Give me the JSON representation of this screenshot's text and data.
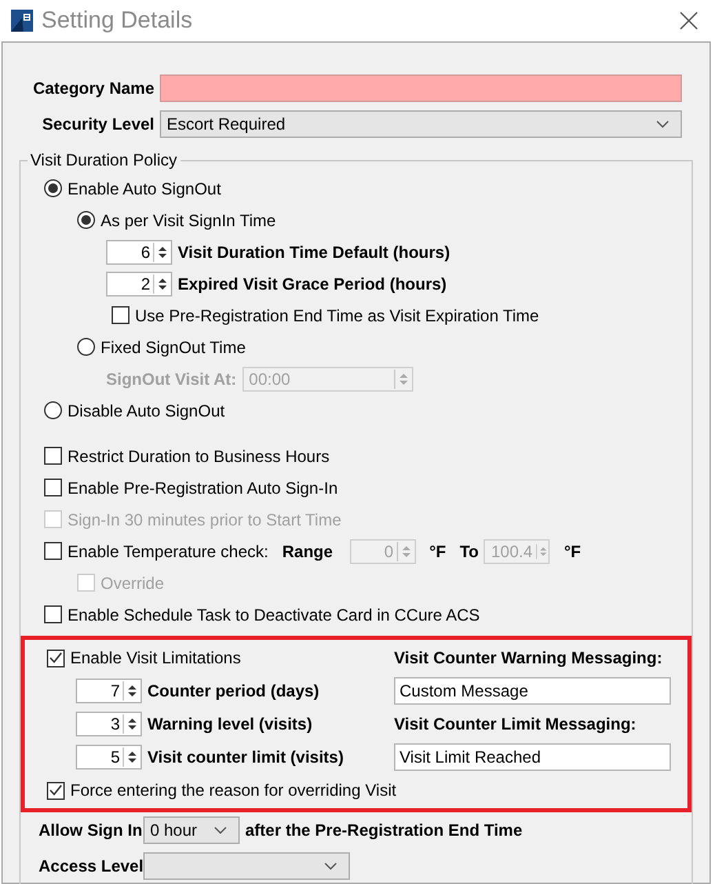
{
  "window": {
    "title": "Setting Details"
  },
  "category_name": {
    "label": "Category Name",
    "invalid": true
  },
  "security_level": {
    "label": "Security Level",
    "value": "Escort Required"
  },
  "visit_duration_policy": {
    "title": "Visit Duration Policy",
    "signout_modes": [
      {
        "kind": "radio",
        "label": "Enable Auto SignOut",
        "selected": true,
        "children": [
          {
            "kind": "radio",
            "label": "As per Visit SignIn Time",
            "selected": true,
            "children": [
              {
                "kind": "spinner",
                "value": "6",
                "label": "Visit Duration Time Default (hours)",
                "disabled": false
              },
              {
                "kind": "spinner",
                "value": "2",
                "label": "Expired Visit Grace Period (hours)",
                "disabled": false
              },
              {
                "kind": "checkbox",
                "label": "Use Pre-Registration End Time as Visit Expiration Time",
                "checked": false,
                "disabled": false
              }
            ]
          },
          {
            "kind": "radio",
            "label": "Fixed SignOut Time",
            "selected": false,
            "children": [
              {
                "kind": "time",
                "label": "SignOut Visit At:",
                "value": "00:00",
                "disabled": true
              }
            ]
          }
        ]
      },
      {
        "kind": "radio",
        "label": "Disable Auto SignOut",
        "selected": false
      }
    ],
    "options": [
      {
        "kind": "checkbox",
        "label": "Restrict Duration to Business Hours",
        "checked": false,
        "disabled": false
      },
      {
        "kind": "checkbox",
        "label": "Enable Pre-Registration Auto Sign-In",
        "checked": false,
        "disabled": false
      },
      {
        "kind": "checkbox",
        "label": "Sign-In 30 minutes prior to Start Time",
        "checked": false,
        "disabled": true
      },
      {
        "kind": "temperature",
        "label": "Enable Temperature check:",
        "checked": false,
        "disabled": false,
        "fields_disabled": true,
        "range_label": "Range",
        "from": "0",
        "from_unit": "°F",
        "to_label": "To",
        "to": "100.4",
        "to_unit": "°F",
        "children": [
          {
            "kind": "checkbox",
            "label": "Override",
            "checked": false,
            "disabled": true
          }
        ]
      },
      {
        "kind": "checkbox",
        "label": "Enable Schedule Task to Deactivate Card in CCure ACS",
        "checked": false,
        "disabled": false
      }
    ],
    "visit_limitations": {
      "highlighted": true,
      "enable": {
        "label": "Enable Visit Limitations",
        "checked": true
      },
      "counters": [
        {
          "value": "7",
          "label": "Counter period (days)"
        },
        {
          "value": "3",
          "label": "Warning level (visits)"
        },
        {
          "value": "5",
          "label": "Visit counter limit (visits)"
        }
      ],
      "force_reason": {
        "label": "Force entering the reason for overriding Visit",
        "checked": true
      },
      "warning_messaging": {
        "label": "Visit Counter Warning Messaging:",
        "value": "Custom Message"
      },
      "limit_messaging": {
        "label": "Visit Counter Limit Messaging:",
        "value": "Visit Limit Reached"
      }
    },
    "allow_sign_in": {
      "label": "Allow Sign In",
      "value": "0 hour",
      "suffix": "after the Pre-Registration End Time"
    },
    "access_level": {
      "label": "Access Level"
    }
  }
}
